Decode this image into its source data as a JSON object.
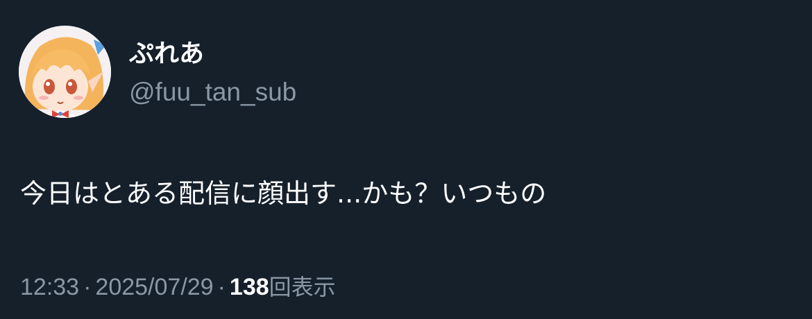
{
  "user": {
    "display_name": "ぷれあ",
    "handle": "@fuu_tan_sub",
    "avatar_icon": "anime-girl-avatar-icon"
  },
  "tweet": {
    "text": "今日はとある配信に顔出す...かも？いつもの"
  },
  "meta": {
    "time": "12:33",
    "separator": "·",
    "date": "2025/07/29",
    "views_count": "138",
    "views_label": "回表示"
  },
  "colors": {
    "background": "#15202b",
    "primary_text": "#ffffff",
    "secondary_text": "#8b98a5"
  }
}
